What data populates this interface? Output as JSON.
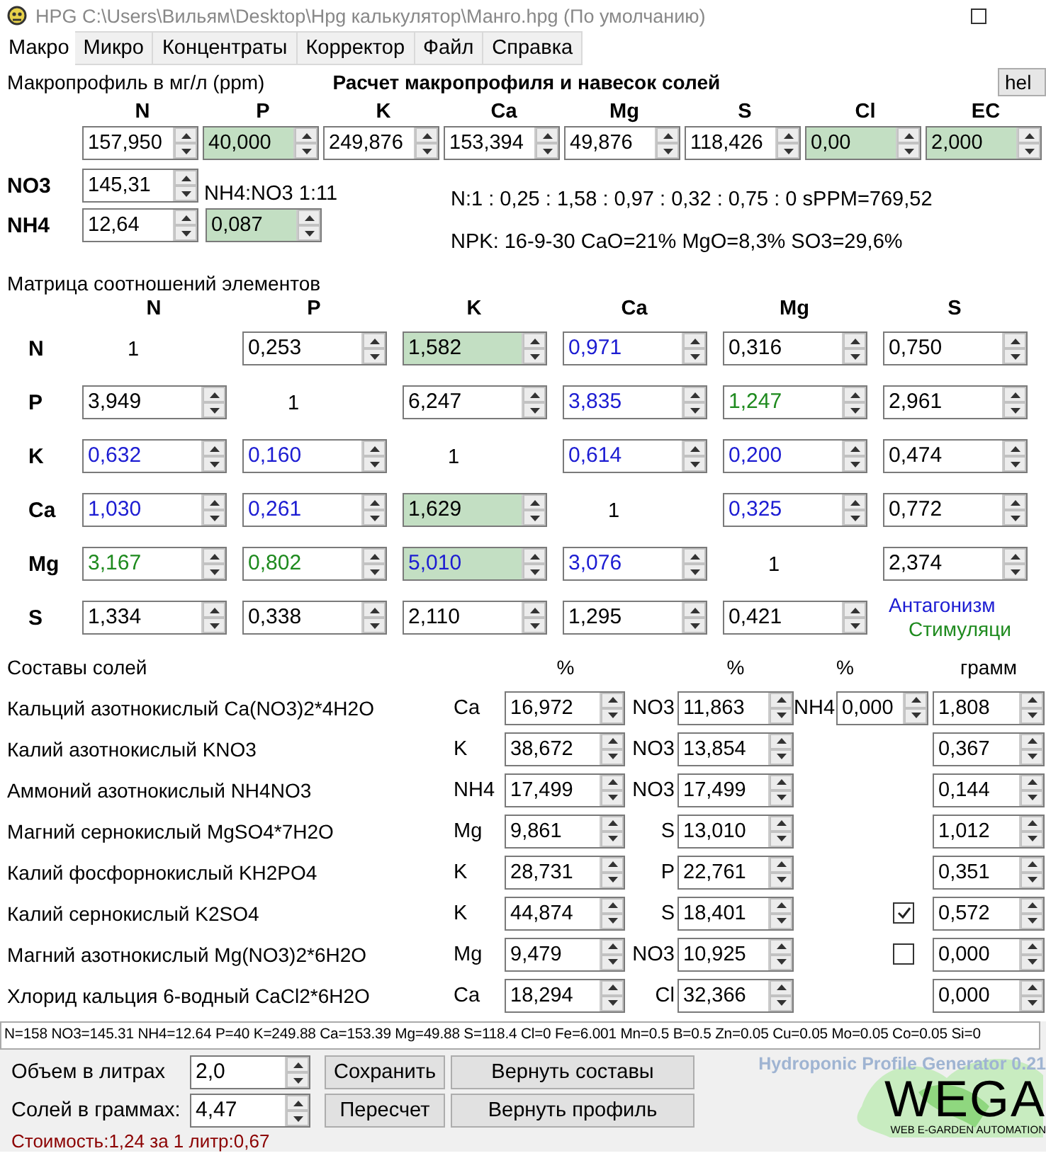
{
  "window": {
    "title": "HPG C:\\Users\\Вильям\\Desktop\\Hpg калькулятор\\Манго.hpg (По умолчанию)"
  },
  "tabs": [
    {
      "label": "Макро",
      "selected": true
    },
    {
      "label": "Микро",
      "selected": false
    },
    {
      "label": "Концентраты",
      "selected": false
    },
    {
      "label": "Корректор",
      "selected": false
    },
    {
      "label": "Файл",
      "selected": false
    },
    {
      "label": "Справка",
      "selected": false
    }
  ],
  "macro": {
    "title": "Макропрофиль в мг/л (ppm)",
    "heading": "Расчет макропрофиля и навесок солей",
    "help_button": "hel",
    "elements": [
      {
        "label": "N",
        "value": "157,950",
        "highlighted": false
      },
      {
        "label": "P",
        "value": "40,000",
        "highlighted": true
      },
      {
        "label": "K",
        "value": "249,876",
        "highlighted": false
      },
      {
        "label": "Ca",
        "value": "153,394",
        "highlighted": false
      },
      {
        "label": "Mg",
        "value": "49,876",
        "highlighted": false
      },
      {
        "label": "S",
        "value": "118,426",
        "highlighted": false
      },
      {
        "label": "Cl",
        "value": "0,00",
        "highlighted": true
      },
      {
        "label": "EC",
        "value": "2,000",
        "highlighted": true
      }
    ],
    "nitrogen": [
      {
        "label": "NO3",
        "value": "145,31",
        "note": "NH4:NO3 1:11"
      },
      {
        "label": "NH4",
        "value": "12,64",
        "share": {
          "value": "0,087",
          "highlighted": true
        }
      }
    ],
    "ratio_line": "N:1 : 0,25 : 1,58 : 0,97 : 0,32 : 0,75 : 0 sPPM=769,52",
    "npk_line": "NPK: 16-9-30 CaO=21% MgO=8,3% SO3=29,6%"
  },
  "matrix": {
    "title": "Матрица соотношений элементов",
    "columns": [
      "N",
      "P",
      "K",
      "Ca",
      "Mg",
      "S"
    ],
    "rows": [
      {
        "label": "N",
        "cells": [
          {
            "kind": "unit",
            "value": "1"
          },
          {
            "kind": "spin",
            "value": "0,253",
            "color": "#000000",
            "highlighted": false
          },
          {
            "kind": "spin",
            "value": "1,582",
            "color": "#000000",
            "highlighted": true
          },
          {
            "kind": "spin",
            "value": "0,971",
            "color": "#1c1cd2",
            "highlighted": false
          },
          {
            "kind": "spin",
            "value": "0,316",
            "color": "#000000",
            "highlighted": false
          },
          {
            "kind": "spin",
            "value": "0,750",
            "color": "#000000",
            "highlighted": false
          }
        ]
      },
      {
        "label": "P",
        "cells": [
          {
            "kind": "spin",
            "value": "3,949",
            "color": "#000000",
            "highlighted": false
          },
          {
            "kind": "unit",
            "value": "1"
          },
          {
            "kind": "spin",
            "value": "6,247",
            "color": "#000000",
            "highlighted": false
          },
          {
            "kind": "spin",
            "value": "3,835",
            "color": "#1c1cd2",
            "highlighted": false
          },
          {
            "kind": "spin",
            "value": "1,247",
            "color": "#1e8a1e",
            "highlighted": false
          },
          {
            "kind": "spin",
            "value": "2,961",
            "color": "#000000",
            "highlighted": false
          }
        ]
      },
      {
        "label": "K",
        "cells": [
          {
            "kind": "spin",
            "value": "0,632",
            "color": "#1c1cd2",
            "highlighted": false
          },
          {
            "kind": "spin",
            "value": "0,160",
            "color": "#1c1cd2",
            "highlighted": false
          },
          {
            "kind": "unit",
            "value": "1"
          },
          {
            "kind": "spin",
            "value": "0,614",
            "color": "#1c1cd2",
            "highlighted": false
          },
          {
            "kind": "spin",
            "value": "0,200",
            "color": "#1c1cd2",
            "highlighted": false
          },
          {
            "kind": "spin",
            "value": "0,474",
            "color": "#000000",
            "highlighted": false
          }
        ]
      },
      {
        "label": "Ca",
        "cells": [
          {
            "kind": "spin",
            "value": "1,030",
            "color": "#1c1cd2",
            "highlighted": false
          },
          {
            "kind": "spin",
            "value": "0,261",
            "color": "#1c1cd2",
            "highlighted": false
          },
          {
            "kind": "spin",
            "value": "1,629",
            "color": "#000000",
            "highlighted": true
          },
          {
            "kind": "unit",
            "value": "1"
          },
          {
            "kind": "spin",
            "value": "0,325",
            "color": "#1c1cd2",
            "highlighted": false
          },
          {
            "kind": "spin",
            "value": "0,772",
            "color": "#000000",
            "highlighted": false
          }
        ]
      },
      {
        "label": "Mg",
        "cells": [
          {
            "kind": "spin",
            "value": "3,167",
            "color": "#1e8a1e",
            "highlighted": false
          },
          {
            "kind": "spin",
            "value": "0,802",
            "color": "#1e8a1e",
            "highlighted": false
          },
          {
            "kind": "spin",
            "value": "5,010",
            "color": "#1c1cd2",
            "highlighted": true
          },
          {
            "kind": "spin",
            "value": "3,076",
            "color": "#1c1cd2",
            "highlighted": false
          },
          {
            "kind": "unit",
            "value": "1"
          },
          {
            "kind": "spin",
            "value": "2,374",
            "color": "#000000",
            "highlighted": false
          }
        ]
      },
      {
        "label": "S",
        "cells": [
          {
            "kind": "spin",
            "value": "1,334",
            "color": "#000000",
            "highlighted": false
          },
          {
            "kind": "spin",
            "value": "0,338",
            "color": "#000000",
            "highlighted": false
          },
          {
            "kind": "spin",
            "value": "2,110",
            "color": "#000000",
            "highlighted": false
          },
          {
            "kind": "spin",
            "value": "1,295",
            "color": "#000000",
            "highlighted": false
          },
          {
            "kind": "spin",
            "value": "0,421",
            "color": "#000000",
            "highlighted": false
          }
        ]
      }
    ],
    "legend": [
      {
        "label": "Антагонизм",
        "color": "#1c1cd2"
      },
      {
        "label": "Стимуляци",
        "color": "#1e8a1e"
      }
    ]
  },
  "salts": {
    "title": "Составы солей",
    "headers": [
      "%",
      "%",
      "%",
      "грамм"
    ],
    "rows": [
      {
        "name": "Кальций азотнокислый Ca(NO3)2*4H2O",
        "el1": "Ca",
        "pct1": "16,972",
        "el2": "NO3",
        "pct2": "11,863",
        "extra": {
          "kind": "spin",
          "label": "NH4",
          "value": "0,000"
        },
        "grams": "1,808"
      },
      {
        "name": "Калий азотнокислый KNO3",
        "el1": "K",
        "pct1": "38,672",
        "el2": "NO3",
        "pct2": "13,854",
        "grams": "0,367"
      },
      {
        "name": "Аммоний азотнокислый NH4NO3",
        "el1": "NH4",
        "pct1": "17,499",
        "el2": "NO3",
        "pct2": "17,499",
        "grams": "0,144"
      },
      {
        "name": "Магний сернокислый MgSO4*7H2O",
        "el1": "Mg",
        "pct1": "9,861",
        "el2": "S",
        "pct2": "13,010",
        "grams": "1,012"
      },
      {
        "name": "Калий фосфорнокислый KH2PO4",
        "el1": "K",
        "pct1": "28,731",
        "el2": "P",
        "pct2": "22,761",
        "grams": "0,351"
      },
      {
        "name": "Калий сернокислый K2SO4",
        "el1": "K",
        "pct1": "44,874",
        "el2": "S",
        "pct2": "18,401",
        "extra": {
          "kind": "checkbox",
          "checked": true
        },
        "grams": "0,572"
      },
      {
        "name": "Магний азотнокислый Mg(NO3)2*6H2O",
        "el1": "Mg",
        "pct1": "9,479",
        "el2": "NO3",
        "pct2": "10,925",
        "extra": {
          "kind": "checkbox",
          "checked": false
        },
        "grams": "0,000"
      },
      {
        "name": "Хлорид кальция 6-водный CaCl2*6H2O",
        "el1": "Ca",
        "pct1": "18,294",
        "el2": "Cl",
        "pct2": "32,366",
        "grams": "0,000"
      }
    ]
  },
  "status_line": "N=158 NO3=145.31 NH4=12.64 P=40 K=249.88 Ca=153.39 Mg=49.88 S=118.4 Cl=0 Fe=6.001 Mn=0.5 B=0.5 Zn=0.05 Cu=0.05 Mo=0.05 Co=0.05 Si=0",
  "bottom": {
    "fields": [
      {
        "label": "Объем в литрах",
        "value": "2,0"
      },
      {
        "label": "Солей в граммах:",
        "value": "4,47"
      }
    ],
    "buttons": [
      [
        "Сохранить",
        "Вернуть составы"
      ],
      [
        "Пересчет",
        "Вернуть профиль"
      ]
    ],
    "version": "Hydroponic Profile Generator 0.21",
    "logo": {
      "title": "WEGA",
      "subtitle": "WEB E-GARDEN AUTOMATION"
    },
    "cost": "Стоимость:1,24 за 1 литр:0,67"
  }
}
